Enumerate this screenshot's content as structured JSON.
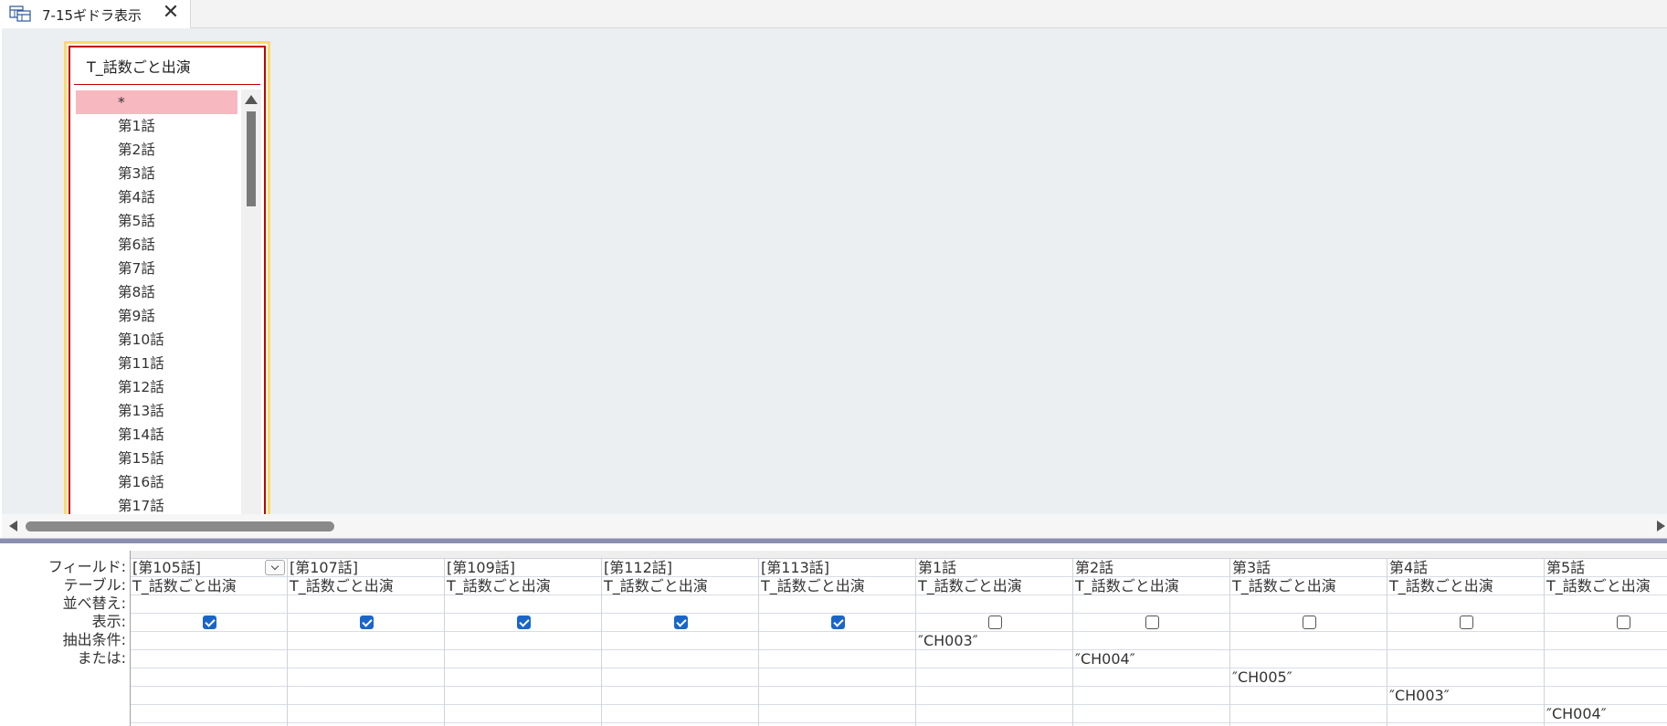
{
  "tab": {
    "title": "7-15ギドラ表示",
    "close_glyph": "✕",
    "icon": "query-design-icon"
  },
  "table": {
    "title": "T_話数ごと出演",
    "fields": [
      "*",
      "第1話",
      "第2話",
      "第3話",
      "第4話",
      "第5話",
      "第6話",
      "第7話",
      "第8話",
      "第9話",
      "第10話",
      "第11話",
      "第12話",
      "第13話",
      "第14話",
      "第15話",
      "第16話",
      "第17話"
    ],
    "selected_index": 0
  },
  "grid": {
    "row_labels": [
      "フィールド:",
      "テーブル:",
      "並べ替え:",
      "表示:",
      "抽出条件:",
      "または:"
    ],
    "columns": [
      {
        "field": "[第105話]",
        "table": "T_話数ごと出演",
        "sort": "",
        "show": true,
        "criteria": [
          "",
          "",
          "",
          "",
          ""
        ]
      },
      {
        "field": "[第107話]",
        "table": "T_話数ごと出演",
        "sort": "",
        "show": true,
        "criteria": [
          "",
          "",
          "",
          "",
          ""
        ]
      },
      {
        "field": "[第109話]",
        "table": "T_話数ごと出演",
        "sort": "",
        "show": true,
        "criteria": [
          "",
          "",
          "",
          "",
          ""
        ]
      },
      {
        "field": "[第112話]",
        "table": "T_話数ごと出演",
        "sort": "",
        "show": true,
        "criteria": [
          "",
          "",
          "",
          "",
          ""
        ]
      },
      {
        "field": "[第113話]",
        "table": "T_話数ごと出演",
        "sort": "",
        "show": true,
        "criteria": [
          "",
          "",
          "",
          "",
          ""
        ]
      },
      {
        "field": "第1話",
        "table": "T_話数ごと出演",
        "sort": "",
        "show": false,
        "criteria": [
          "″CH003″",
          "",
          "",
          "",
          ""
        ]
      },
      {
        "field": "第2話",
        "table": "T_話数ごと出演",
        "sort": "",
        "show": false,
        "criteria": [
          "",
          "″CH004″",
          "",
          "",
          ""
        ]
      },
      {
        "field": "第3話",
        "table": "T_話数ごと出演",
        "sort": "",
        "show": false,
        "criteria": [
          "",
          "",
          "″CH005″",
          "",
          ""
        ]
      },
      {
        "field": "第4話",
        "table": "T_話数ごと出演",
        "sort": "",
        "show": false,
        "criteria": [
          "",
          "",
          "",
          "″CH003″",
          ""
        ]
      },
      {
        "field": "第5話",
        "table": "T_話数ごと出演",
        "sort": "",
        "show": false,
        "criteria": [
          "",
          "",
          "",
          "",
          "″CH004″"
        ]
      }
    ]
  },
  "colors": {
    "selection": "#f8b8c0",
    "table_border": "#c00000",
    "table_highlight": "#ffd966",
    "checkbox_checked": "#1a66c8",
    "design_background": "#eceff2"
  }
}
